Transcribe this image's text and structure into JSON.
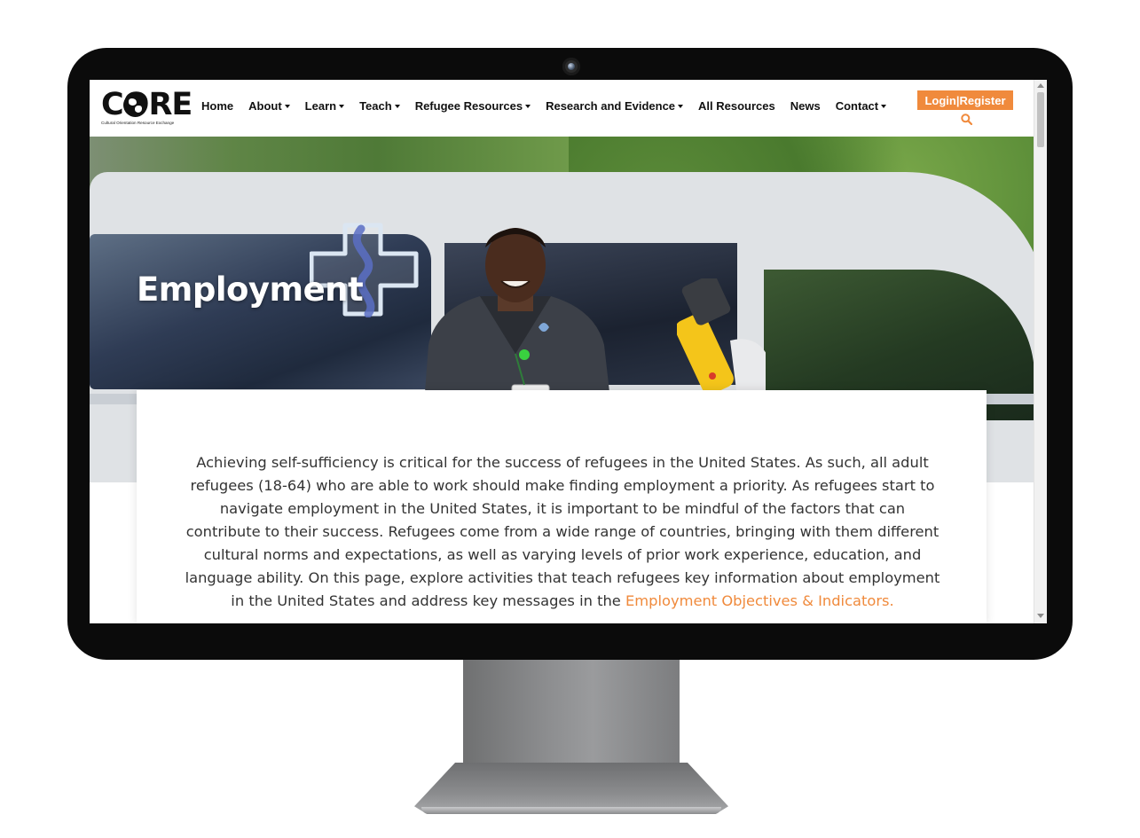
{
  "logo": {
    "word": "CORE",
    "tagline": "Cultural Orientation Resource Exchange"
  },
  "nav": {
    "items": [
      {
        "label": "Home",
        "dropdown": false
      },
      {
        "label": "About",
        "dropdown": true
      },
      {
        "label": "Learn",
        "dropdown": true
      },
      {
        "label": "Teach",
        "dropdown": true
      },
      {
        "label": "Refugee Resources",
        "dropdown": true
      },
      {
        "label": "Research and Evidence",
        "dropdown": true
      },
      {
        "label": "All Resources",
        "dropdown": false
      },
      {
        "label": "News",
        "dropdown": false
      },
      {
        "label": "Contact",
        "dropdown": true
      }
    ],
    "login_label": "Login|Register",
    "search_icon": "search-icon"
  },
  "hero": {
    "title": "Employment"
  },
  "intro": {
    "text": "Achieving self-sufficiency is critical for the success of refugees in the United States. As such, all adult refugees (18-64) who are able to work should make finding employment a priority. As refugees start to navigate employment in the United States, it is important to be mindful of the factors that can contribute to their success. Refugees come from a wide range of countries, bringing with them different cultural norms and expectations, as well as varying levels of prior work experience, education, and language ability. On this page, explore activities that teach refugees key information about employment in the United States and address key messages in the ",
    "link": "Employment Objectives & Indicators."
  },
  "colors": {
    "accent": "#f08a3c",
    "text": "#333333",
    "bezel": "#0b0b0b"
  }
}
